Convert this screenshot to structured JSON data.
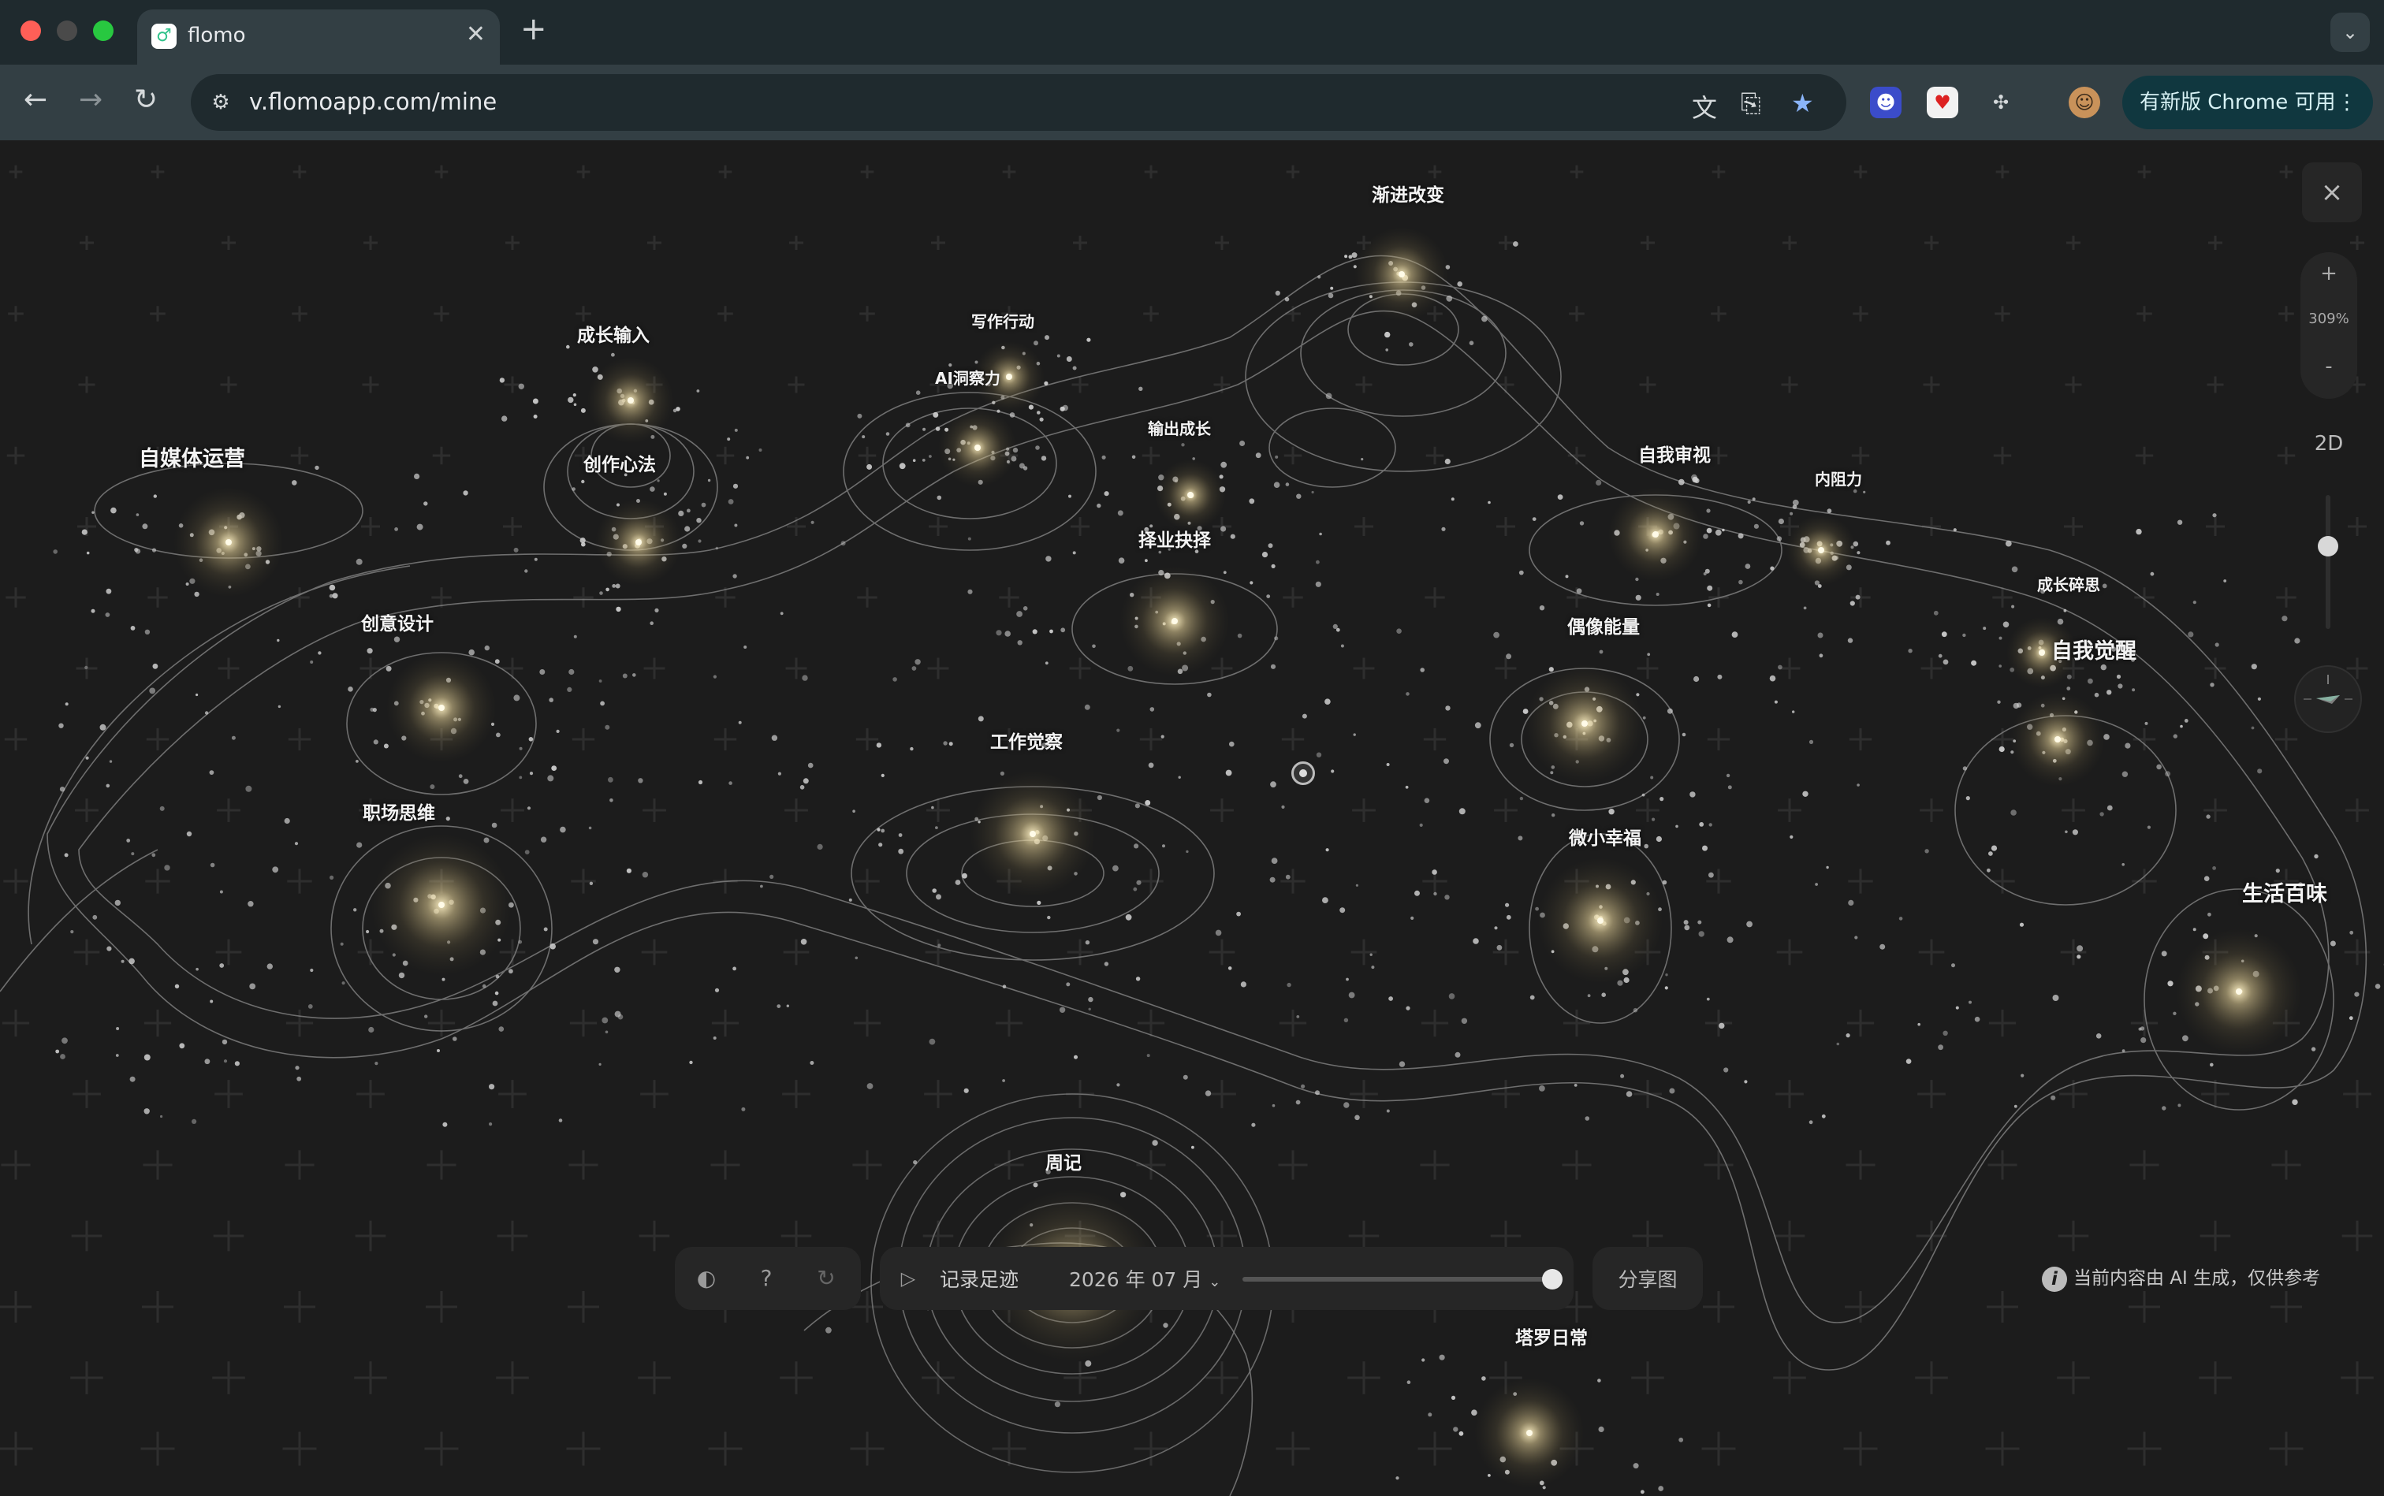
{
  "browser": {
    "tab": {
      "title": "flomo",
      "favicon": "flomo-logo-icon"
    },
    "url": "v.flomoapp.com/mine",
    "update_button": "有新版 Chrome 可用",
    "colors": {
      "tabstrip": "#1f2a2e",
      "toolbar": "#333f44",
      "update_button": "#10373f"
    }
  },
  "map": {
    "labels": [
      {
        "text": "渐进改变"
      },
      {
        "text": "成长输入"
      },
      {
        "text": "写作行动"
      },
      {
        "text": "AI洞察力"
      },
      {
        "text": "输出成长"
      },
      {
        "text": "自媒体运营"
      },
      {
        "text": "创作心法"
      },
      {
        "text": "择业抉择"
      },
      {
        "text": "自我审视"
      },
      {
        "text": "内阻力"
      },
      {
        "text": "成长碎思"
      },
      {
        "text": "自我觉醒"
      },
      {
        "text": "创意设计"
      },
      {
        "text": "偶像能量"
      },
      {
        "text": "工作觉察"
      },
      {
        "text": "职场思维"
      },
      {
        "text": "微小幸福"
      },
      {
        "text": "生活百味"
      },
      {
        "text": "周记"
      },
      {
        "text": "塔罗日常"
      }
    ],
    "zoom_level": "309%",
    "zoom_in": "+",
    "zoom_out": "-",
    "view_mode": "2D",
    "close": "×"
  },
  "bottom_bar": {
    "play_label": "记录足迹",
    "date": "2026 年 07 月",
    "timeline_progress": 1.0,
    "share_label": "分享图",
    "ai_note": "当前内容由 AI 生成，仅供参考"
  }
}
